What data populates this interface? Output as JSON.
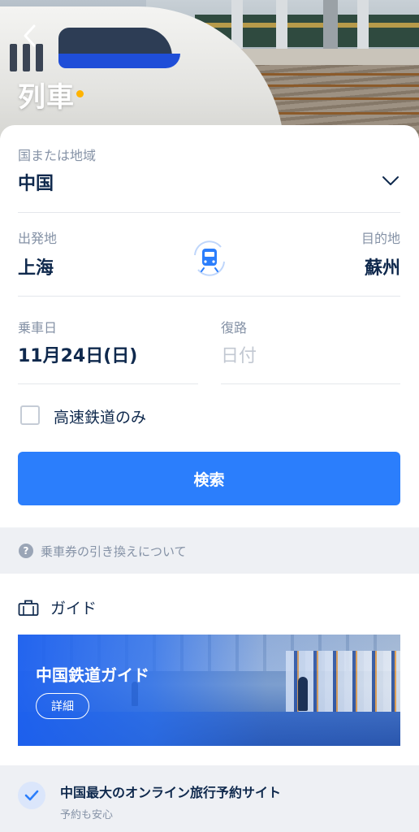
{
  "header": {
    "title": "列車",
    "back_icon": "chevron-left-icon"
  },
  "form": {
    "region": {
      "label": "国または地域",
      "value": "中国"
    },
    "departure": {
      "label": "出発地",
      "value": "上海"
    },
    "arrival": {
      "label": "目的地",
      "value": "蘇州"
    },
    "depart_date": {
      "label": "乗車日",
      "value": "11月24日(日)"
    },
    "return_date": {
      "label": "復路",
      "placeholder": "日付"
    },
    "high_speed_only": {
      "label": "高速鉄道のみ",
      "checked": false
    },
    "search_label": "検索"
  },
  "info": {
    "text": "乗車券の引き換えについて",
    "icon": "question-icon"
  },
  "guide": {
    "heading": "ガイド",
    "heading_icon": "briefcase-icon",
    "banner": {
      "title": "中国鉄道ガイド",
      "detail_label": "詳細"
    }
  },
  "feature": {
    "title": "中国最大のオンライン旅行予約サイト",
    "subtitle": "予約も安心",
    "icon": "check-circle-icon"
  },
  "colors": {
    "accent": "#2b7efc",
    "title_dot": "#ffb300",
    "text_primary": "#0f294d",
    "text_secondary": "#8592a6"
  }
}
